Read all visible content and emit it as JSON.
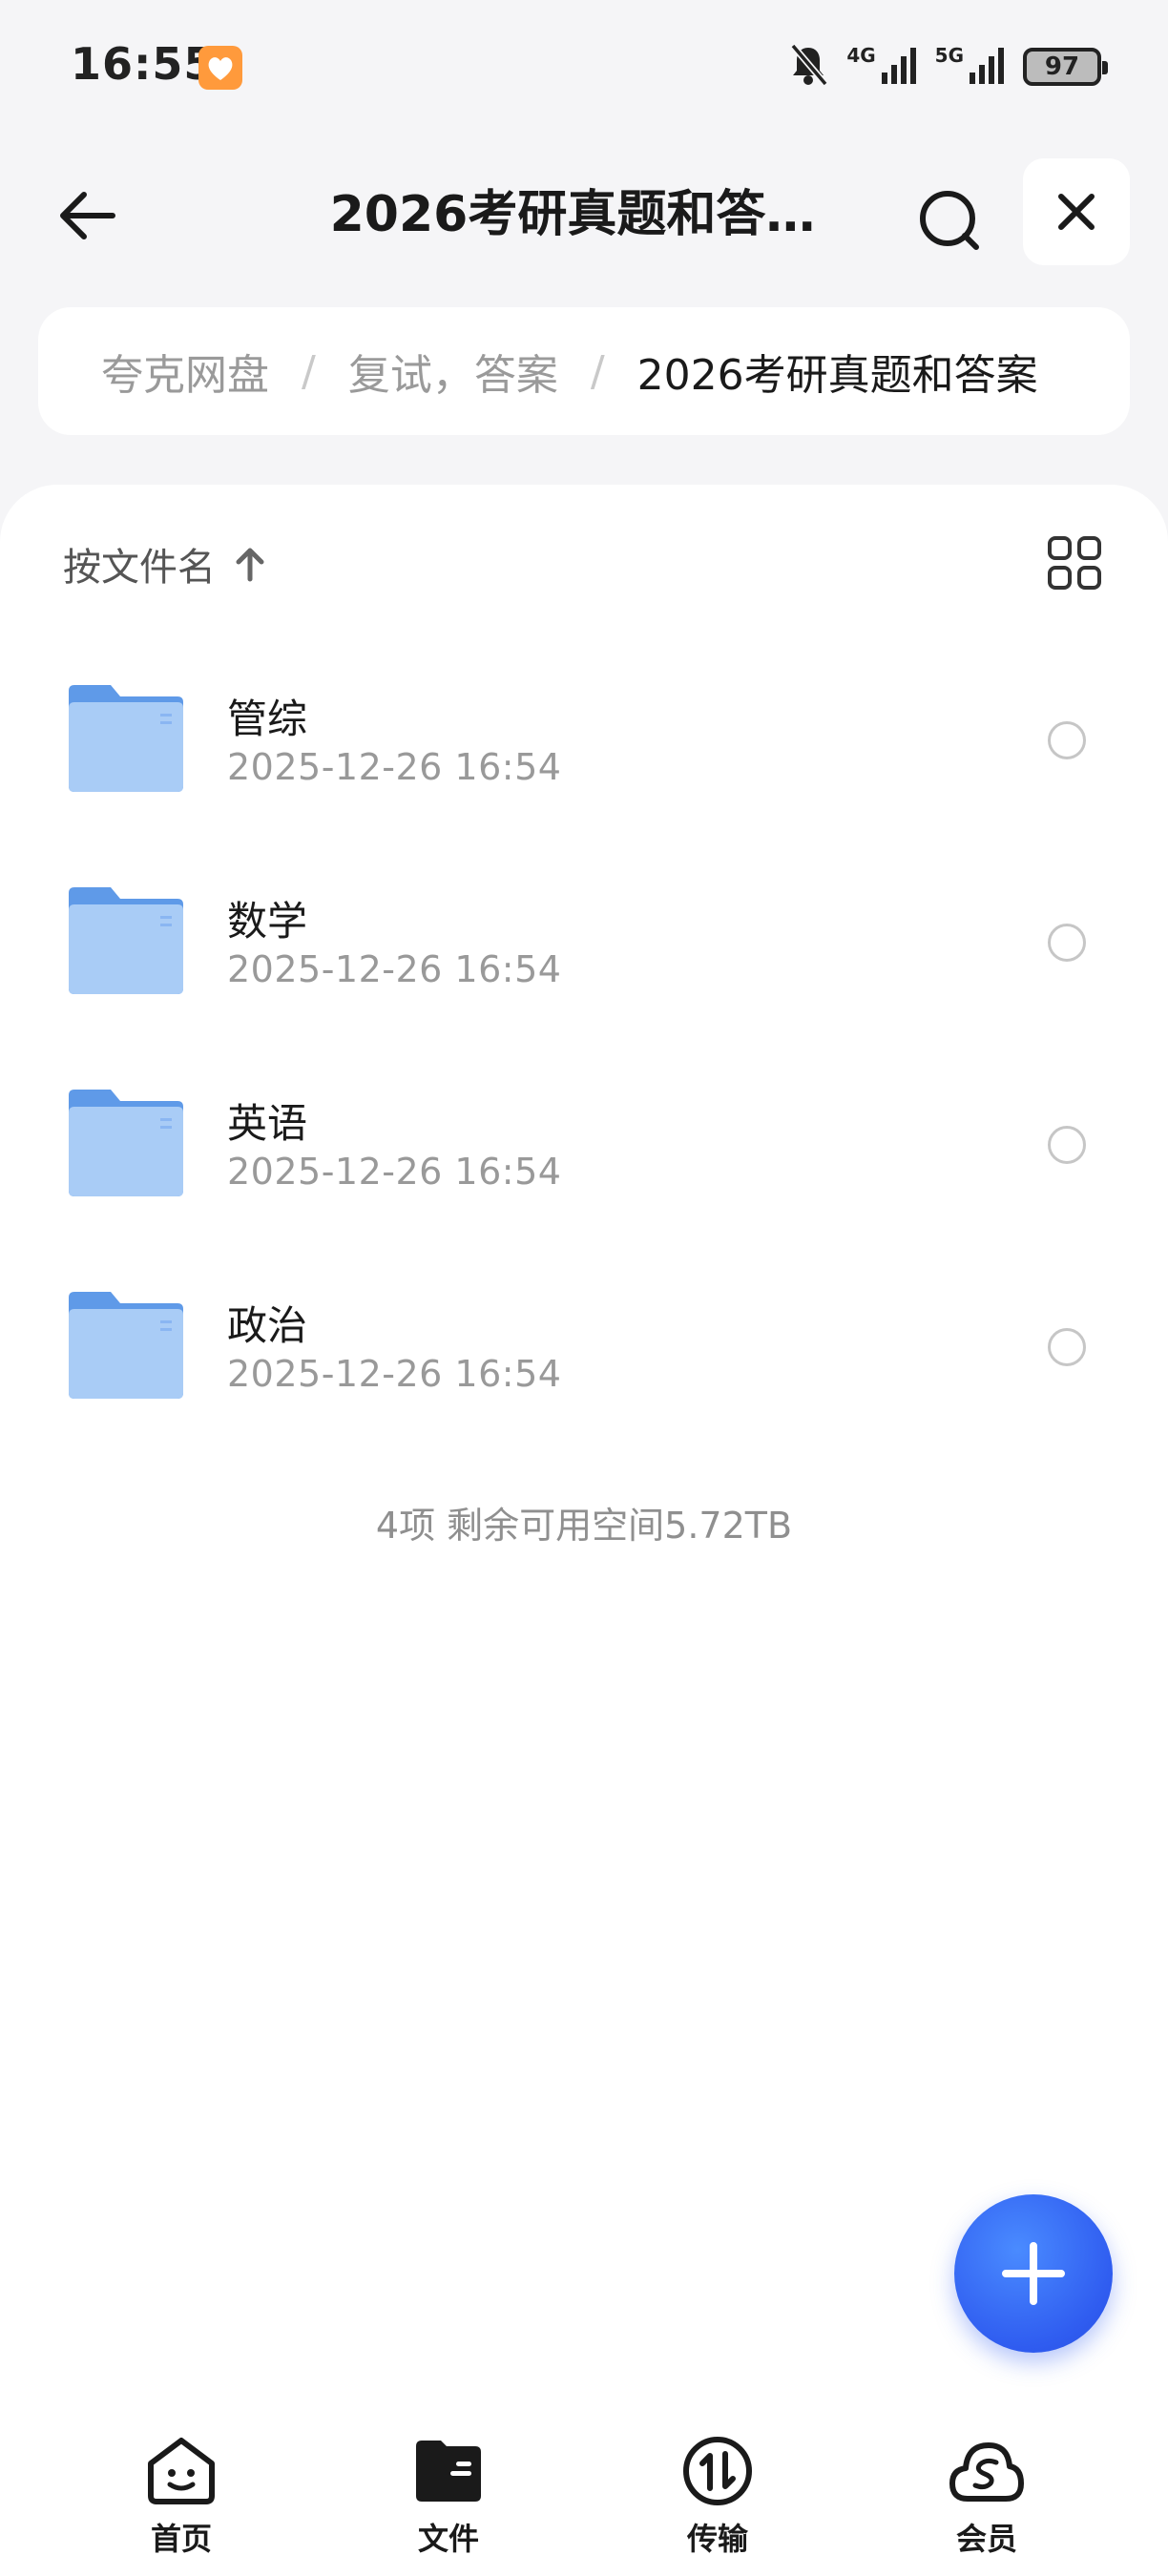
{
  "status_bar": {
    "time": "16:55",
    "network_1": "4G",
    "network_2": "5G",
    "battery": "97"
  },
  "nav": {
    "title": "2026考研真题和答…"
  },
  "breadcrumb": {
    "items": [
      "夸克网盘",
      "复试，答案",
      "2026考研真题和答案"
    ],
    "separator": "/"
  },
  "sort": {
    "label": "按文件名"
  },
  "files": [
    {
      "name": "管综",
      "date": "2025-12-26 16:54"
    },
    {
      "name": "数学",
      "date": "2025-12-26 16:54"
    },
    {
      "name": "英语",
      "date": "2025-12-26 16:54"
    },
    {
      "name": "政治",
      "date": "2025-12-26 16:54"
    }
  ],
  "summary": "4项 剩余可用空间5.72TB",
  "tabs": [
    {
      "label": "首页"
    },
    {
      "label": "文件"
    },
    {
      "label": "传输"
    },
    {
      "label": "会员"
    }
  ],
  "colors": {
    "accent": "#2f5cf0",
    "folder": "#8ab6f2",
    "app_badge": "#ff9a3c"
  }
}
